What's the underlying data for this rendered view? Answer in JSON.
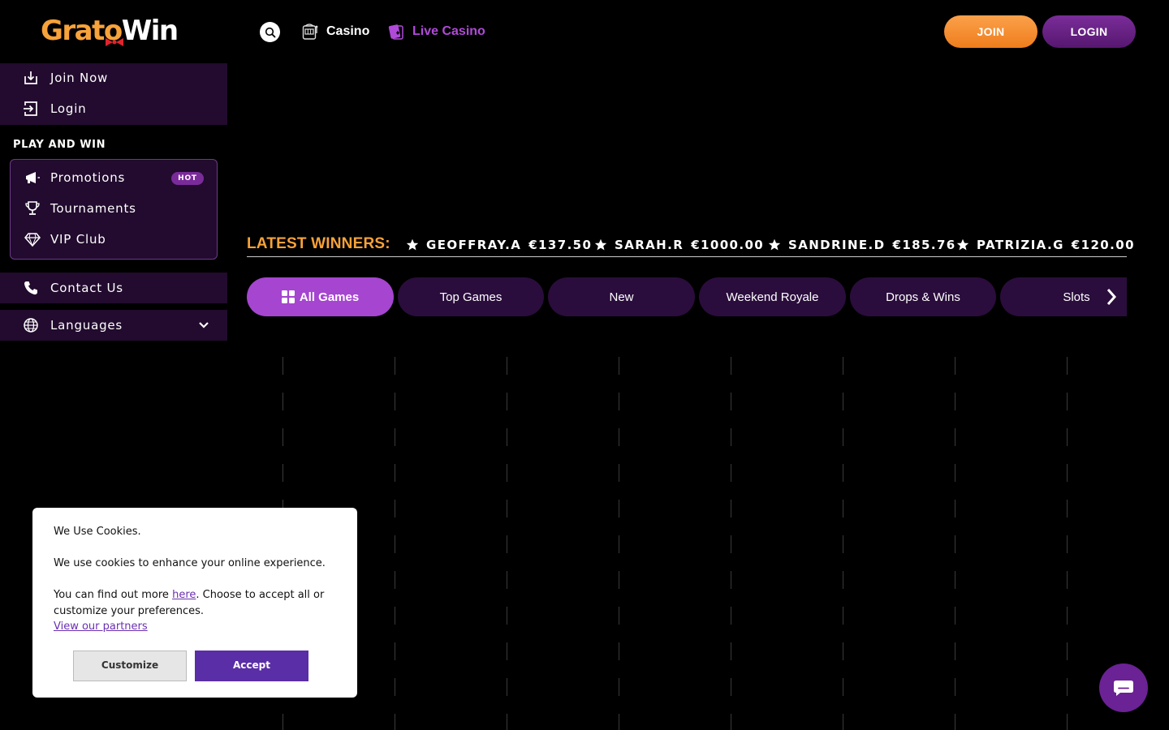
{
  "brand": {
    "logo_part1": "Grato",
    "logo_part2": "Win",
    "accent": "#f7a23a",
    "purple": "#a545d0"
  },
  "header": {
    "nav": [
      {
        "label": "Casino",
        "icon": "slot-machine-icon"
      },
      {
        "label": "Live Casino",
        "icon": "cards-icon"
      }
    ],
    "join_label": "JOIN",
    "login_label": "LOGIN"
  },
  "sidebar": {
    "top_items": [
      {
        "label": "Join Now",
        "icon": "download-icon"
      },
      {
        "label": "Login",
        "icon": "login-icon"
      }
    ],
    "heading": "PLAY AND WIN",
    "play_items": [
      {
        "label": "Promotions",
        "icon": "megaphone-icon",
        "badge": "HOT"
      },
      {
        "label": "Tournaments",
        "icon": "trophy-icon"
      },
      {
        "label": "VIP Club",
        "icon": "diamond-icon"
      }
    ],
    "contact": {
      "label": "Contact Us",
      "icon": "phone-icon"
    },
    "languages": {
      "label": "Languages",
      "icon": "globe-icon"
    }
  },
  "winners": {
    "title": "LATEST WINNERS:",
    "items": [
      {
        "name": "GEOFFRAY.A",
        "amount": "€137.50"
      },
      {
        "name": "SARAH.R",
        "amount": "€1000.00"
      },
      {
        "name": "SANDRINE.D",
        "amount": "€185.76"
      },
      {
        "name": "PATRIZIA.G",
        "amount": "€120.00"
      }
    ]
  },
  "tabs": [
    "All Games",
    "Top Games",
    "New",
    "Weekend Royale",
    "Drops & Wins",
    "Slots"
  ],
  "cookie": {
    "title": "We Use Cookies.",
    "body1": "We use cookies to enhance your online experience.",
    "body2_prefix": "You can find out more ",
    "body2_link": "here",
    "body2_suffix": ". Choose to accept all or customize your preferences.",
    "partners_link": "View our partners",
    "customize_label": "Customize",
    "accept_label": "Accept"
  }
}
